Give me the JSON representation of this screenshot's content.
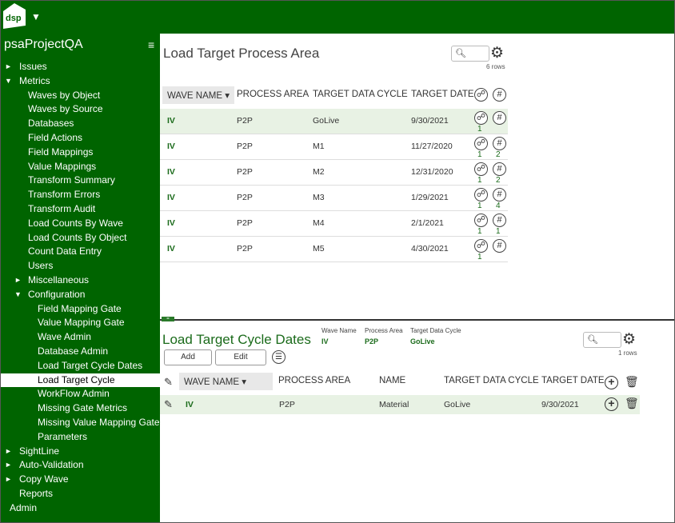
{
  "app": {
    "logo_text": "dsp",
    "project": "psaProjectQA"
  },
  "sidebar": {
    "items": [
      {
        "label": "Issues",
        "level": 0,
        "arrow": "►"
      },
      {
        "label": "Metrics",
        "level": 0,
        "arrow": "▼"
      },
      {
        "label": "Waves by Object",
        "level": 1
      },
      {
        "label": "Waves by Source",
        "level": 1
      },
      {
        "label": "Databases",
        "level": 1
      },
      {
        "label": "Field Actions",
        "level": 1
      },
      {
        "label": "Field Mappings",
        "level": 1
      },
      {
        "label": "Value Mappings",
        "level": 1
      },
      {
        "label": "Transform Summary",
        "level": 1
      },
      {
        "label": "Transform Errors",
        "level": 1
      },
      {
        "label": "Transform Audit",
        "level": 1
      },
      {
        "label": "Load Counts By Wave",
        "level": 1
      },
      {
        "label": "Load Counts By Object",
        "level": 1
      },
      {
        "label": "Count Data Entry",
        "level": 1
      },
      {
        "label": "Users",
        "level": 1
      },
      {
        "label": "Miscellaneous",
        "level": 1,
        "arrow": "►"
      },
      {
        "label": "Configuration",
        "level": 1,
        "arrow": "▼"
      },
      {
        "label": "Field Mapping Gate",
        "level": 2
      },
      {
        "label": "Value Mapping Gate",
        "level": 2
      },
      {
        "label": "Wave Admin",
        "level": 2
      },
      {
        "label": "Database Admin",
        "level": 2
      },
      {
        "label": "Load Target Cycle Dates",
        "level": 2
      },
      {
        "label": "Load Target Cycle",
        "level": 2,
        "active": true
      },
      {
        "label": "WorkFlow Admin",
        "level": 2
      },
      {
        "label": "Missing Gate Metrics",
        "level": 2
      },
      {
        "label": "Missing Value Mapping Gate",
        "level": 2
      },
      {
        "label": "Parameters",
        "level": 2
      },
      {
        "label": "SightLine",
        "level": 0,
        "arrow": "►"
      },
      {
        "label": "Auto-Validation",
        "level": 0,
        "arrow": "►"
      },
      {
        "label": "Copy Wave",
        "level": 0,
        "arrow": "►"
      },
      {
        "label": "Reports",
        "level": 0
      },
      {
        "label": "Admin",
        "level": 0,
        "top": true
      }
    ]
  },
  "panel1": {
    "title": "Load Target Process Area",
    "rows_info": "6 rows",
    "headers": {
      "wave": "WAVE NAME ▾",
      "area": "PROCESS AREA",
      "cycle": "TARGET DATA CYCLE",
      "date": "TARGET DATE"
    },
    "rows": [
      {
        "wave": "IV",
        "area": "P2P",
        "cycle": "GoLive",
        "date": "9/30/2021",
        "c1": "1",
        "c2": ""
      },
      {
        "wave": "IV",
        "area": "P2P",
        "cycle": "M1",
        "date": "11/27/2020",
        "c1": "1",
        "c2": "2"
      },
      {
        "wave": "IV",
        "area": "P2P",
        "cycle": "M2",
        "date": "12/31/2020",
        "c1": "1",
        "c2": "2"
      },
      {
        "wave": "IV",
        "area": "P2P",
        "cycle": "M3",
        "date": "1/29/2021",
        "c1": "1",
        "c2": "4"
      },
      {
        "wave": "IV",
        "area": "P2P",
        "cycle": "M4",
        "date": "2/1/2021",
        "c1": "1",
        "c2": "1"
      },
      {
        "wave": "IV",
        "area": "P2P",
        "cycle": "M5",
        "date": "4/30/2021",
        "c1": "1",
        "c2": ""
      }
    ]
  },
  "panel2": {
    "title": "Load Target Cycle Dates",
    "filters": [
      {
        "label": "Wave Name",
        "value": "IV"
      },
      {
        "label": "Process Area",
        "value": "P2P"
      },
      {
        "label": "Target Data Cycle",
        "value": "GoLive"
      }
    ],
    "add_label": "Add",
    "edit_label": "Edit",
    "rows_info": "1 rows",
    "headers": {
      "wave": "WAVE NAME ▾",
      "area": "PROCESS AREA",
      "name": "NAME",
      "cycle": "TARGET DATA CYCLE",
      "date": "TARGET DATE"
    },
    "row": {
      "wave": "IV",
      "area": "P2P",
      "name": "Material",
      "cycle": "GoLive",
      "date": "9/30/2021"
    }
  }
}
